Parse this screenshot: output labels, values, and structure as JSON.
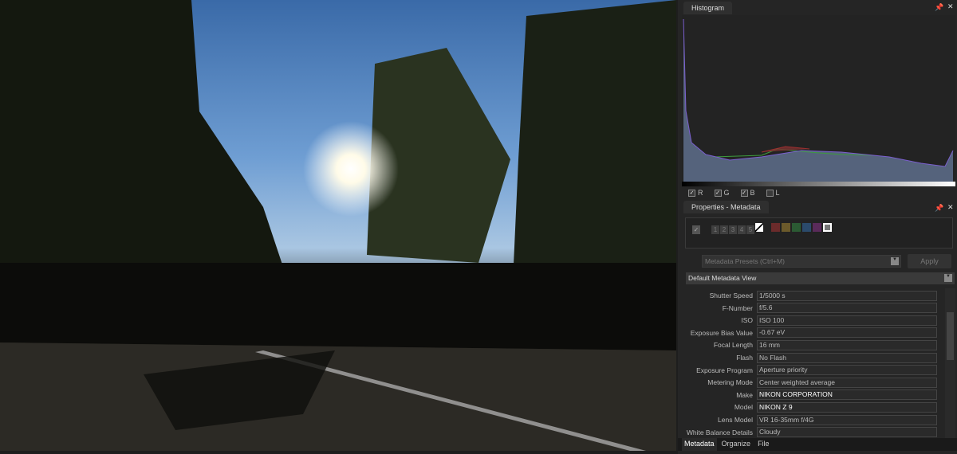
{
  "histogram": {
    "title": "Histogram",
    "channels": [
      {
        "label": "R",
        "checked": true
      },
      {
        "label": "G",
        "checked": true
      },
      {
        "label": "B",
        "checked": true
      },
      {
        "label": "L",
        "checked": false
      }
    ]
  },
  "properties": {
    "title": "Properties - Metadata",
    "ratings": [
      "1",
      "2",
      "3",
      "4",
      "5"
    ],
    "color_labels": [
      "#6b2b2b",
      "#6b5a2b",
      "#2b5a33",
      "#2b4a6b",
      "#5a2b5a",
      "#888888"
    ],
    "presets_placeholder": "Metadata Presets (Ctrl+M)",
    "apply_label": "Apply",
    "view_select": "Default Metadata View",
    "fields": [
      {
        "label": "Shutter Speed",
        "value": "1/5000 s"
      },
      {
        "label": "F-Number",
        "value": "f/5.6"
      },
      {
        "label": "ISO",
        "value": "ISO 100"
      },
      {
        "label": "Exposure Bias Value",
        "value": "-0.67 eV"
      },
      {
        "label": "Focal Length",
        "value": "16 mm"
      },
      {
        "label": "Flash",
        "value": "No Flash"
      },
      {
        "label": "Exposure Program",
        "value": "Aperture priority"
      },
      {
        "label": "Metering Mode",
        "value": "Center weighted average"
      },
      {
        "label": "Make",
        "value": "NIKON CORPORATION"
      },
      {
        "label": "Model",
        "value": "NIKON Z 9"
      },
      {
        "label": "Lens Model",
        "value": "VR 16-35mm f/4G"
      },
      {
        "label": "White Balance Details",
        "value": "Cloudy"
      }
    ],
    "bottom_tabs": [
      "Metadata",
      "Organize",
      "File"
    ]
  }
}
